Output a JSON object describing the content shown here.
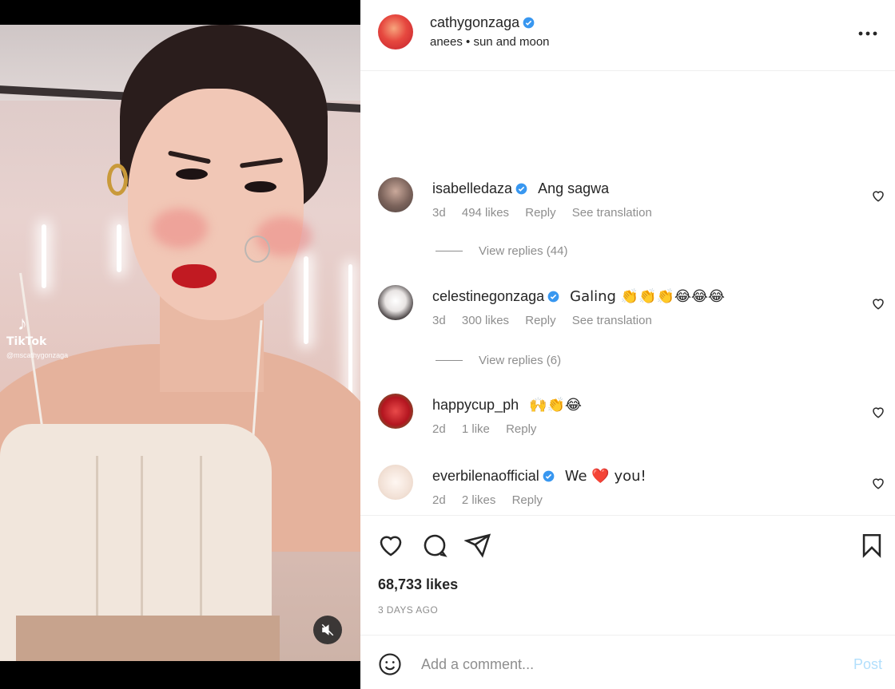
{
  "media": {
    "watermark": {
      "brand": "TikTok",
      "handle": "@mscathygonzaga"
    },
    "mute_icon": "speaker-muted-icon"
  },
  "post": {
    "author": "cathygonzaga",
    "audio": "anees • sun and moon",
    "more_icon": "more-horizontal-icon"
  },
  "comments": [
    {
      "user": "isabelledaza",
      "verified": true,
      "text": "Ang sagwa",
      "age": "3d",
      "likes": "494 likes",
      "reply": "Reply",
      "translate": "See translation",
      "replies": "View replies (44)"
    },
    {
      "user": "celestinegonzaga",
      "verified": true,
      "text": "Galing 👏👏👏😂😂😂",
      "age": "3d",
      "likes": "300 likes",
      "reply": "Reply",
      "translate": "See translation",
      "replies": "View replies (6)"
    },
    {
      "user": "happycup_ph",
      "verified": false,
      "text": "🙌👏😂",
      "age": "2d",
      "likes": "1 like",
      "reply": "Reply"
    },
    {
      "user": "everbilenaofficial",
      "verified": true,
      "text": "We ❤️ you!",
      "age": "2d",
      "likes": "2 likes",
      "reply": "Reply"
    }
  ],
  "actions": {
    "likes": "68,733 likes",
    "posted": "3 DAYS AGO"
  },
  "composer": {
    "placeholder": "Add a comment...",
    "post_label": "Post"
  },
  "colors": {
    "verified": "#3897f0",
    "muted_text": "#8e8e8e",
    "post_disabled": "#b2dffc"
  }
}
